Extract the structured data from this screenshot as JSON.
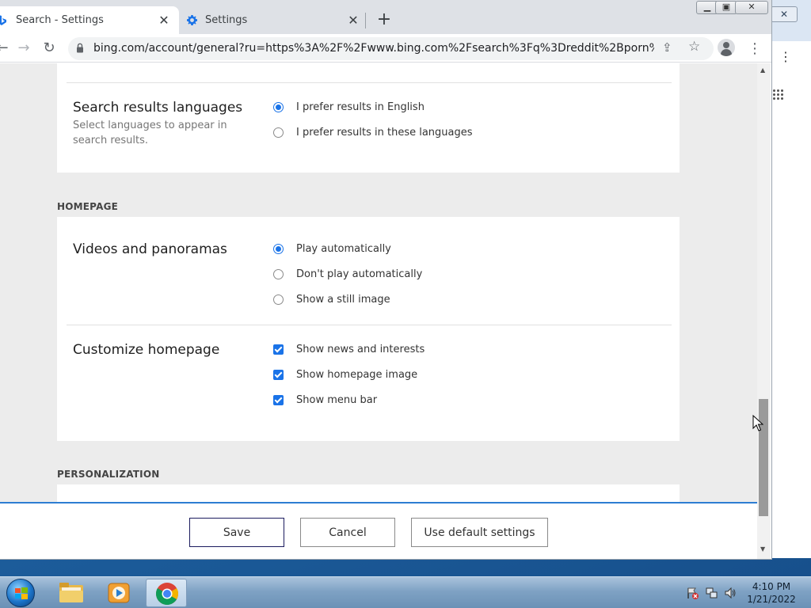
{
  "browser": {
    "tabs": [
      {
        "title": "Search - Settings",
        "active": true
      },
      {
        "title": "Settings",
        "active": false
      }
    ],
    "window_controls": {
      "close": "✕"
    },
    "url": "bing.com/account/general?ru=https%3A%2F%2Fwww.bing.com%2Fsearch%3Fq%3Dreddit%2Bporn%26form%3..."
  },
  "settings": {
    "search_results_languages": {
      "title": "Search results languages",
      "description": "Select languages to appear in search results.",
      "options": [
        "I prefer results in English",
        "I prefer results in these languages"
      ],
      "selected": 0
    },
    "homepage_heading": "HOMEPAGE",
    "videos_and_panoramas": {
      "title": "Videos and panoramas",
      "options": [
        "Play automatically",
        "Don't play automatically",
        "Show a still image"
      ],
      "selected": 0
    },
    "customize_homepage": {
      "title": "Customize homepage",
      "options": [
        "Show news and interests",
        "Show homepage image",
        "Show menu bar"
      ],
      "checked": [
        true,
        true,
        true
      ]
    },
    "personalization_heading": "PERSONALIZATION"
  },
  "actions": {
    "save": "Save",
    "cancel": "Cancel",
    "defaults": "Use default settings"
  },
  "taskbar": {
    "time": "4:10 PM",
    "date": "1/21/2022",
    "apps": [
      "windows-explorer",
      "media-player",
      "chrome"
    ]
  },
  "colors": {
    "accent": "#1a73e8",
    "primary_button_border": "#1b1b5e",
    "page_background": "#ececec"
  }
}
